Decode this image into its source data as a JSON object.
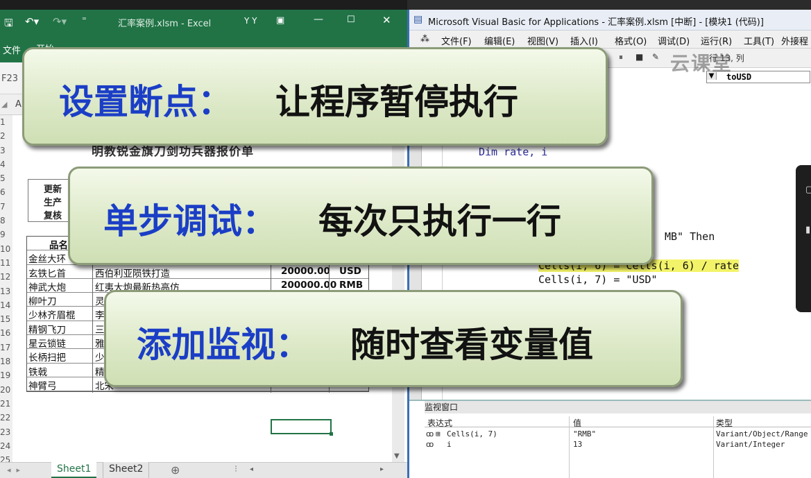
{
  "excel": {
    "title": "汇率案例.xlsm - Excel",
    "user": "Y Y",
    "file_tab": "文件",
    "home_tab": "开始",
    "name_box": "F23",
    "col_a": "A",
    "row_numbers": [
      "1",
      "2",
      "3",
      "4",
      "5",
      "6",
      "7",
      "8",
      "9",
      "10",
      "11",
      "12",
      "13",
      "14",
      "15",
      "16",
      "17",
      "18",
      "19",
      "20",
      "21",
      "22",
      "23",
      "24",
      "25"
    ],
    "sheet_title": "明教锐金旗刀剑功兵器报价单",
    "info": [
      "更新",
      "生产",
      "复核"
    ],
    "table_header": "品名",
    "rows": [
      {
        "name": "金丝大环",
        "desc": "",
        "price": "",
        "cur": ""
      },
      {
        "name": "玄铁匕首",
        "desc": "西伯利亚陨铁打造",
        "price": "20000.00",
        "cur": "USD"
      },
      {
        "name": "神武大炮",
        "desc": "红夷大炮最新热高仿",
        "price": "200000.00",
        "cur": "RMB"
      },
      {
        "name": "柳叶刀",
        "desc": "灵",
        "price": "",
        "cur": ""
      },
      {
        "name": "少林齐眉棍",
        "desc": "李",
        "price": "",
        "cur": ""
      },
      {
        "name": "精钢飞刀",
        "desc": "三",
        "price": "",
        "cur": ""
      },
      {
        "name": "星云锁链",
        "desc": "雅",
        "price": "",
        "cur": ""
      },
      {
        "name": "长柄扫把",
        "desc": "少",
        "price": "",
        "cur": ""
      },
      {
        "name": "铁戟",
        "desc": "精",
        "price": "",
        "cur": ""
      },
      {
        "name": "神臂弓",
        "desc": "北宋",
        "price": "",
        "cur": ""
      }
    ],
    "sheets": [
      "Sheet1",
      "Sheet2"
    ],
    "active_sheet": "Sheet1",
    "accent": "#217346"
  },
  "vba": {
    "title": "Microsoft Visual Basic for Applications - 汇率案例.xlsm [中断] - [模块1 (代码)]",
    "menu": [
      "文件(F)",
      "编辑(E)",
      "视图(V)",
      "插入(I)",
      "格式(O)",
      "调试(D)",
      "运行(R)",
      "工具(T)",
      "外接程"
    ],
    "cursor_pos": "行 13, 列",
    "proc_dropdown": "toUSD",
    "code": {
      "dim_line": "Dim rate, i",
      "if_tail": "MB\" Then",
      "hl_line": "Cells(i, 6) = Cells(i, 6) / rate",
      "next_line": "Cells(i, 7) = \"USD\""
    },
    "watch": {
      "title": "监视窗口",
      "headers": [
        "表达式",
        "值",
        "类型"
      ],
      "rows": [
        {
          "expr": "Cells(i, 7)",
          "value": "\"RMB\"",
          "type": "Variant/Object/Range"
        },
        {
          "expr": "i",
          "value": "13",
          "type": "Variant/Integer"
        }
      ]
    },
    "highlight": "#f3f36a"
  },
  "watermark": "云课堂",
  "callouts": [
    {
      "key": "设置断点：",
      "text": "让程序暂停执行"
    },
    {
      "key": "单步调试：",
      "text": "每次只执行一行"
    },
    {
      "key": "添加监视：",
      "text": "随时查看变量值"
    }
  ],
  "colors": {
    "callout_key": "#1b3ec6",
    "callout_bg": "#dde9c8"
  }
}
